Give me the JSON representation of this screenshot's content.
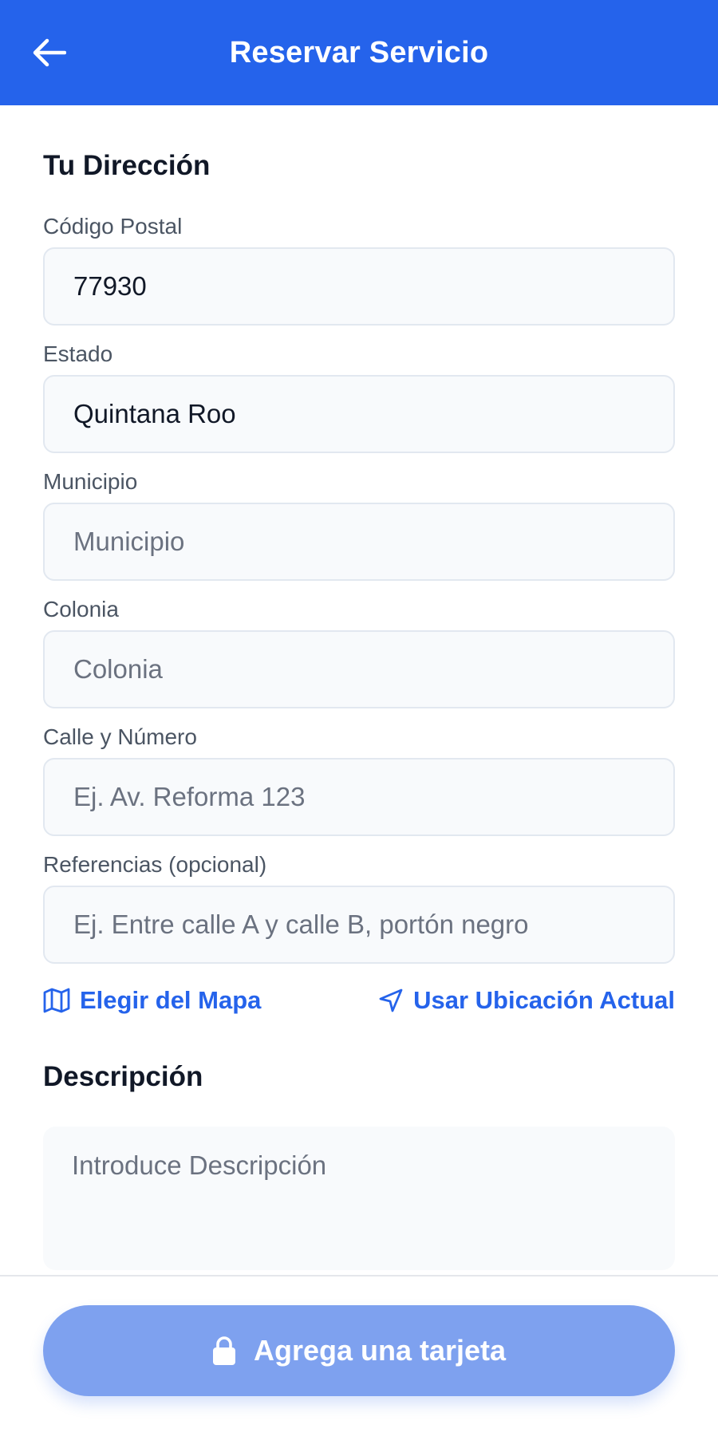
{
  "header": {
    "title": "Reservar Servicio",
    "back_icon": "arrow-left-icon",
    "bg_color": "#2563eb"
  },
  "address": {
    "section_title": "Tu Dirección",
    "fields": [
      {
        "label": "Código Postal",
        "value": "77930",
        "placeholder": ""
      },
      {
        "label": "Estado",
        "value": "Quintana Roo",
        "placeholder": ""
      },
      {
        "label": "Municipio",
        "value": "",
        "placeholder": "Municipio"
      },
      {
        "label": "Colonia",
        "value": "",
        "placeholder": "Colonia"
      },
      {
        "label": "Calle y Número",
        "value": "",
        "placeholder": "Ej. Av. Reforma 123"
      },
      {
        "label": "Referencias (opcional)",
        "value": "",
        "placeholder": "Ej. Entre calle A y calle B, portón negro"
      }
    ],
    "map_link": {
      "label": "Elegir del Mapa",
      "icon": "map-icon"
    },
    "location_link": {
      "label": "Usar Ubicación Actual",
      "icon": "navigation-arrow-icon"
    }
  },
  "description": {
    "section_title": "Descripción",
    "placeholder": "Introduce Descripción",
    "value": ""
  },
  "footer": {
    "button_label": "Agrega una tarjeta",
    "button_icon": "lock-icon",
    "button_color": "#7ea1ef"
  }
}
